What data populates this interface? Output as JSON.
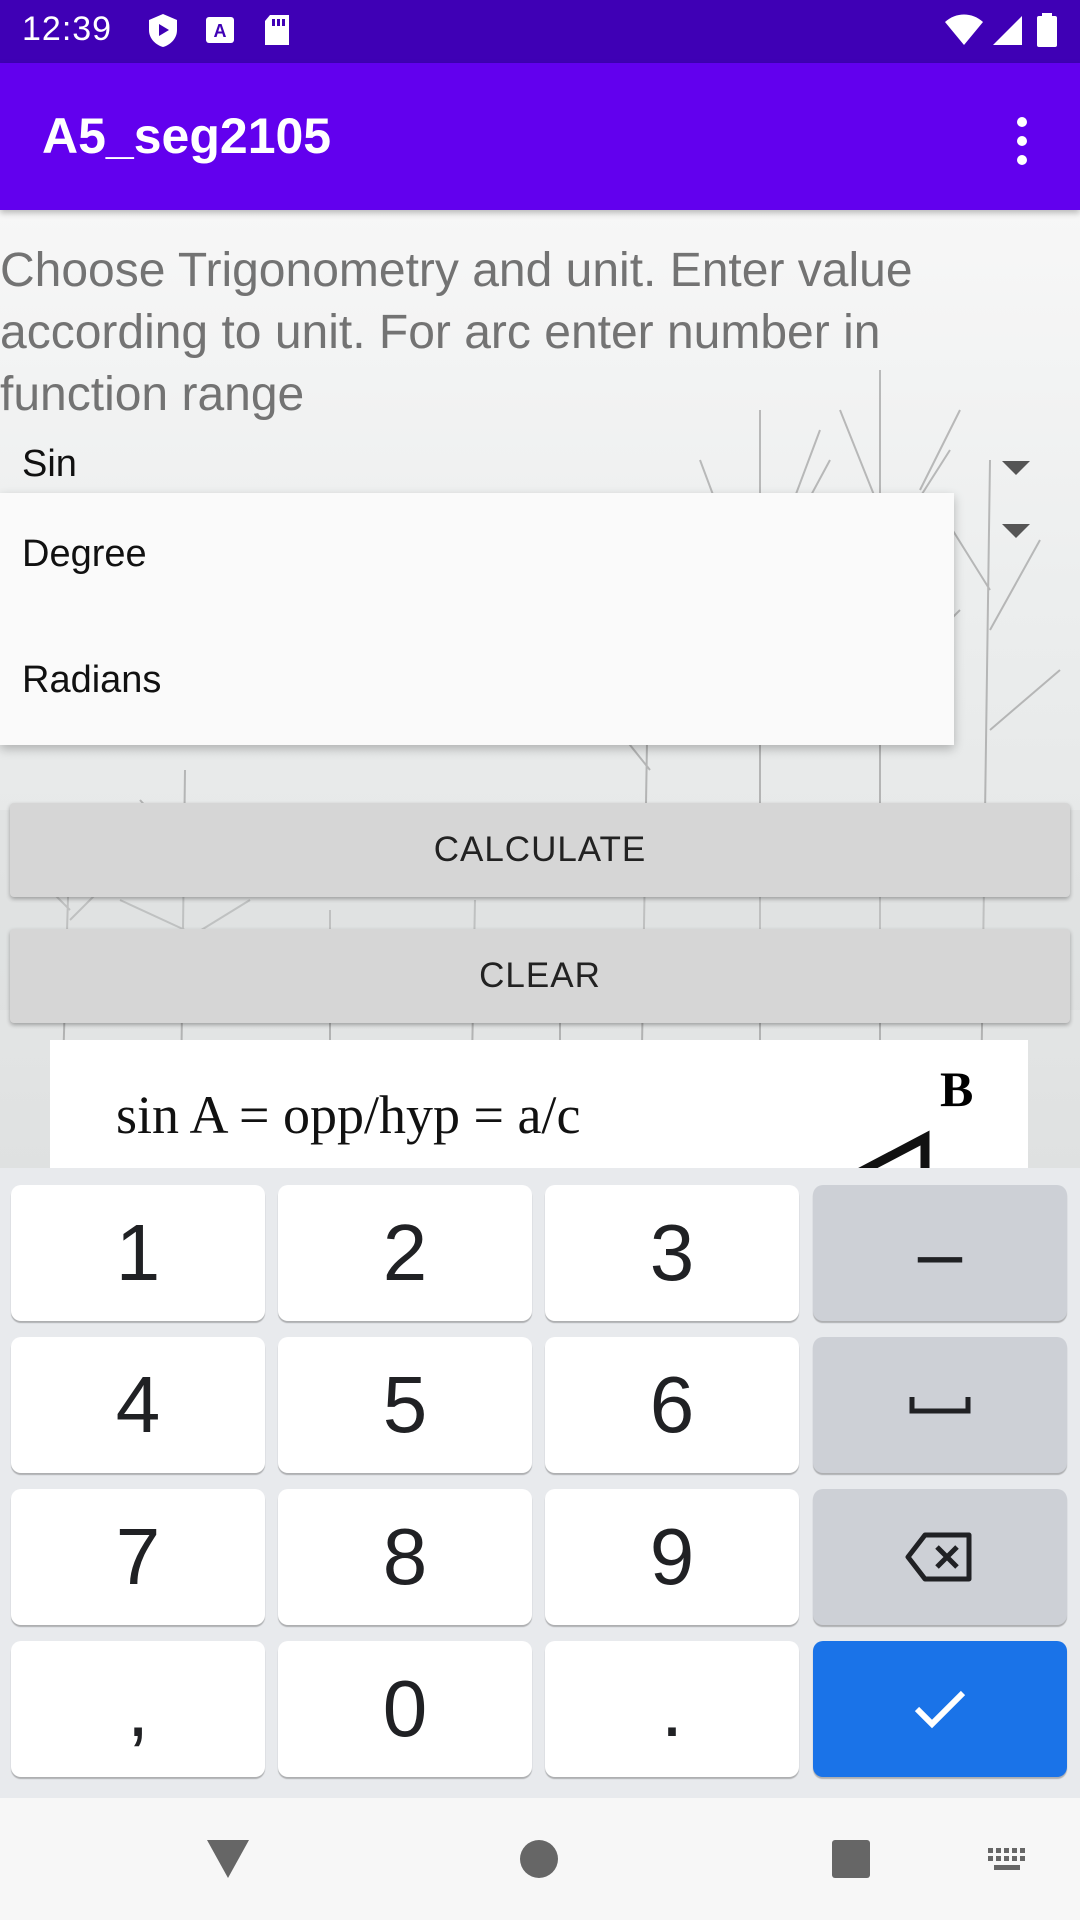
{
  "status_bar": {
    "time": "12:39",
    "icons": [
      "play-protect-icon",
      "accessibility-icon",
      "sd-card-icon",
      "wifi-icon",
      "signal-icon",
      "battery-icon"
    ]
  },
  "app_bar": {
    "title": "A5_seg2105",
    "menu_icon": "overflow-menu-icon",
    "color": "#6200ee"
  },
  "main": {
    "instructions": "Choose Trigonometry and unit. Enter value according to unit. For arc enter number in function range",
    "function_spinner": {
      "selected": "Sin"
    },
    "unit_dropdown": {
      "options": [
        "Degree",
        "Radians"
      ]
    },
    "calculate_label": "CALCULATE",
    "clear_label": "CLEAR",
    "formula_image": {
      "text": "sin A = opp/hyp = a/c",
      "vertex_label": "B"
    }
  },
  "keyboard": {
    "rows": [
      [
        "1",
        "2",
        "3",
        "–"
      ],
      [
        "4",
        "5",
        "6",
        "space"
      ],
      [
        "7",
        "8",
        "9",
        "backspace"
      ],
      [
        ",",
        "0",
        ".",
        "done"
      ]
    ],
    "enter_color": "#1a73e8"
  },
  "nav_bar": {
    "icons": [
      "back-icon",
      "home-icon",
      "recents-icon",
      "keyboard-switch-icon"
    ]
  }
}
